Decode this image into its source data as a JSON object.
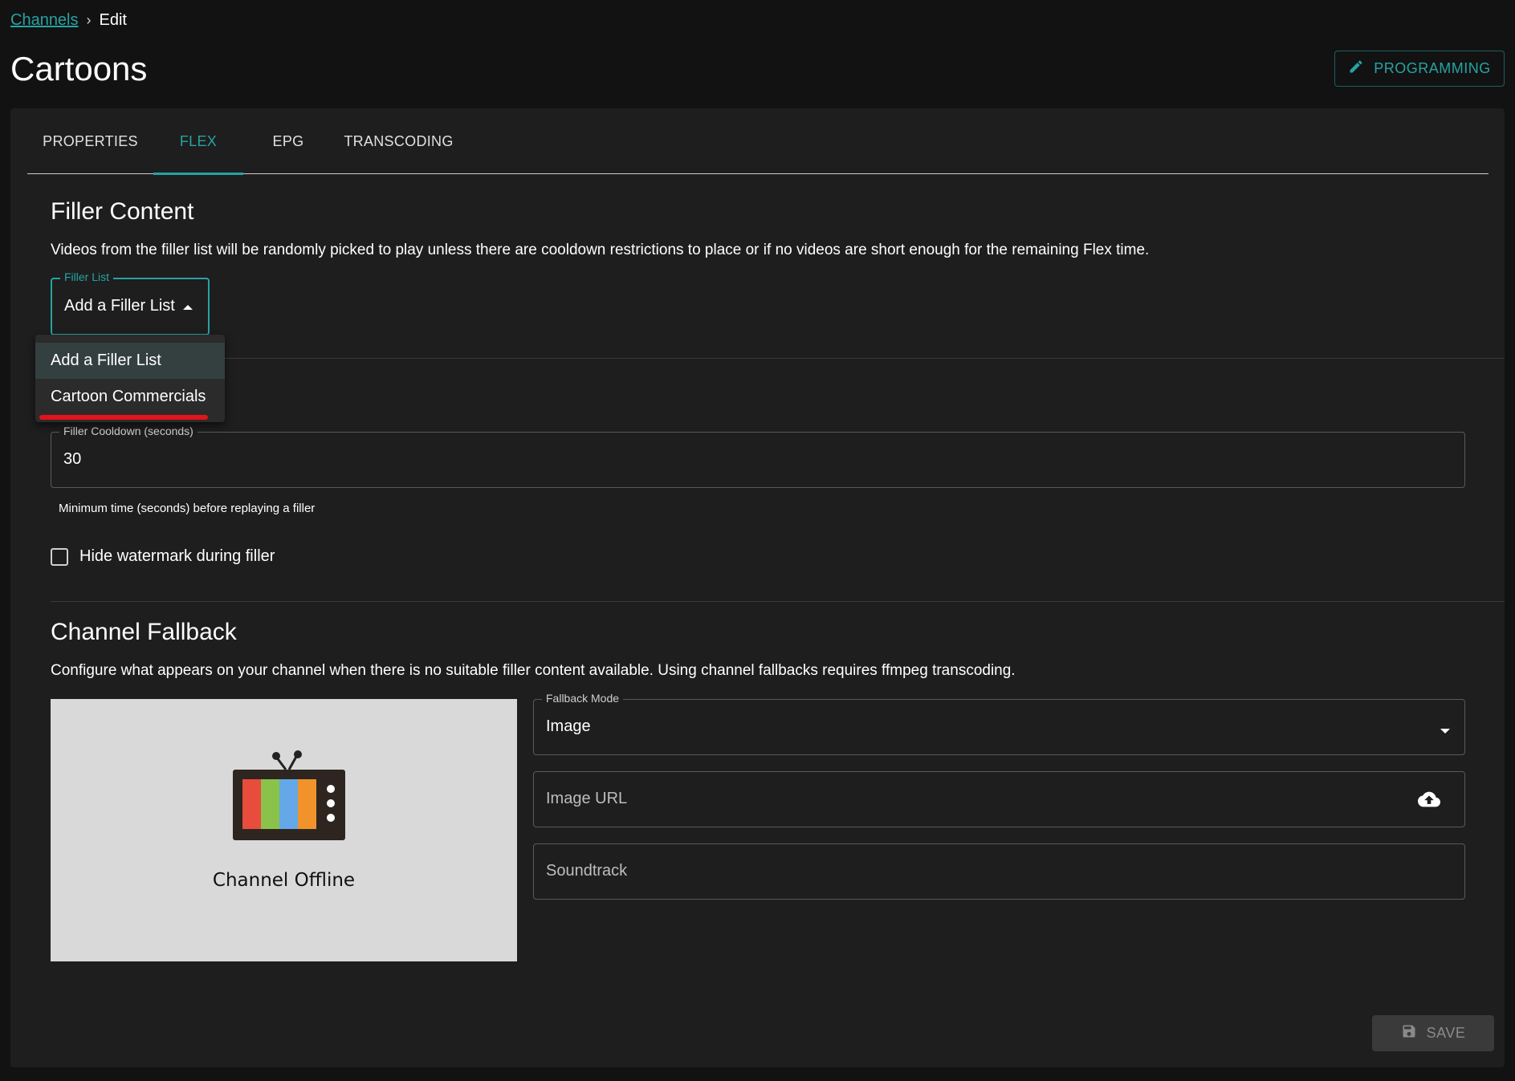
{
  "breadcrumb": {
    "parent": "Channels",
    "separator": "›",
    "current": "Edit"
  },
  "page_title": "Cartoons",
  "header": {
    "programming_label": "PROGRAMMING"
  },
  "tabs": [
    {
      "label": "PROPERTIES",
      "active": false
    },
    {
      "label": "FLEX",
      "active": true
    },
    {
      "label": "EPG",
      "active": false
    },
    {
      "label": "TRANSCODING",
      "active": false
    }
  ],
  "filler": {
    "title": "Filler Content",
    "description": "Videos from the filler list will be randomly picked to play unless there are cooldown restrictions to place or if no videos are short enough for the remaining Flex time.",
    "list_label": "Filler List",
    "list_value": "Add a Filler List",
    "menu_items": [
      "Add a Filler List",
      "Cartoon Commercials"
    ],
    "cooldown_label": "Filler Cooldown (seconds)",
    "cooldown_value": "30",
    "cooldown_helper": "Minimum time (seconds) before replaying a filler",
    "hide_watermark_label": "Hide watermark during filler"
  },
  "fallback": {
    "title": "Channel Fallback",
    "description": "Configure what appears on your channel when there is no suitable filler content available. Using channel fallbacks requires ffmpeg transcoding.",
    "preview_label": "Channel Offline",
    "mode_label": "Fallback Mode",
    "mode_value": "Image",
    "image_url_placeholder": "Image URL",
    "soundtrack_placeholder": "Soundtrack"
  },
  "footer": {
    "save_label": "SAVE"
  },
  "colors": {
    "accent": "#26a3a3",
    "highlight": "#e0141a",
    "background": "#121212",
    "panel": "#1e1e1e"
  },
  "icons": {
    "programming": "pencil-icon",
    "dropdown_open": "caret-up-icon",
    "dropdown": "caret-down-icon",
    "upload": "cloud-upload-icon",
    "save": "floppy-disk-icon",
    "preview": "retro-tv-icon"
  }
}
